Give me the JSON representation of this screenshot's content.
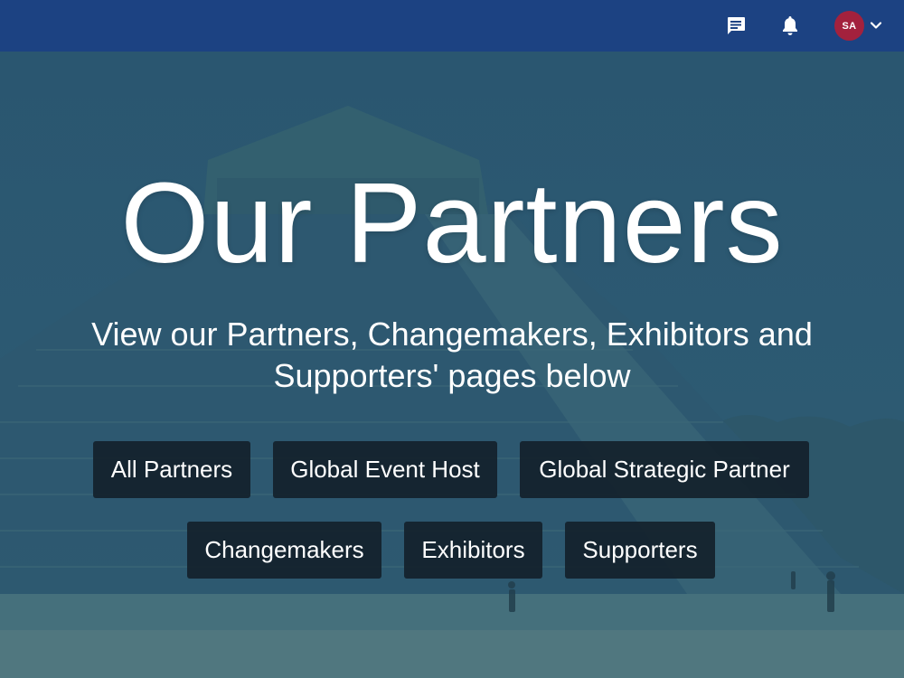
{
  "header": {
    "icons": {
      "messages": "chat-icon",
      "notifications": "bell-icon",
      "menu": "chevron-down-icon"
    },
    "avatar_initials": "SA",
    "colors": {
      "bar": "#1c4282",
      "avatar": "#a3213d"
    }
  },
  "hero": {
    "title": "Our Partners",
    "subtitle": "View our Partners, Changemakers, Exhibitors and Supporters' pages below",
    "buttons": [
      {
        "label": "All Partners"
      },
      {
        "label": "Global Event Host"
      },
      {
        "label": "Global Strategic Partner"
      },
      {
        "label": "Changemakers"
      },
      {
        "label": "Exhibitors"
      },
      {
        "label": "Supporters"
      }
    ]
  }
}
